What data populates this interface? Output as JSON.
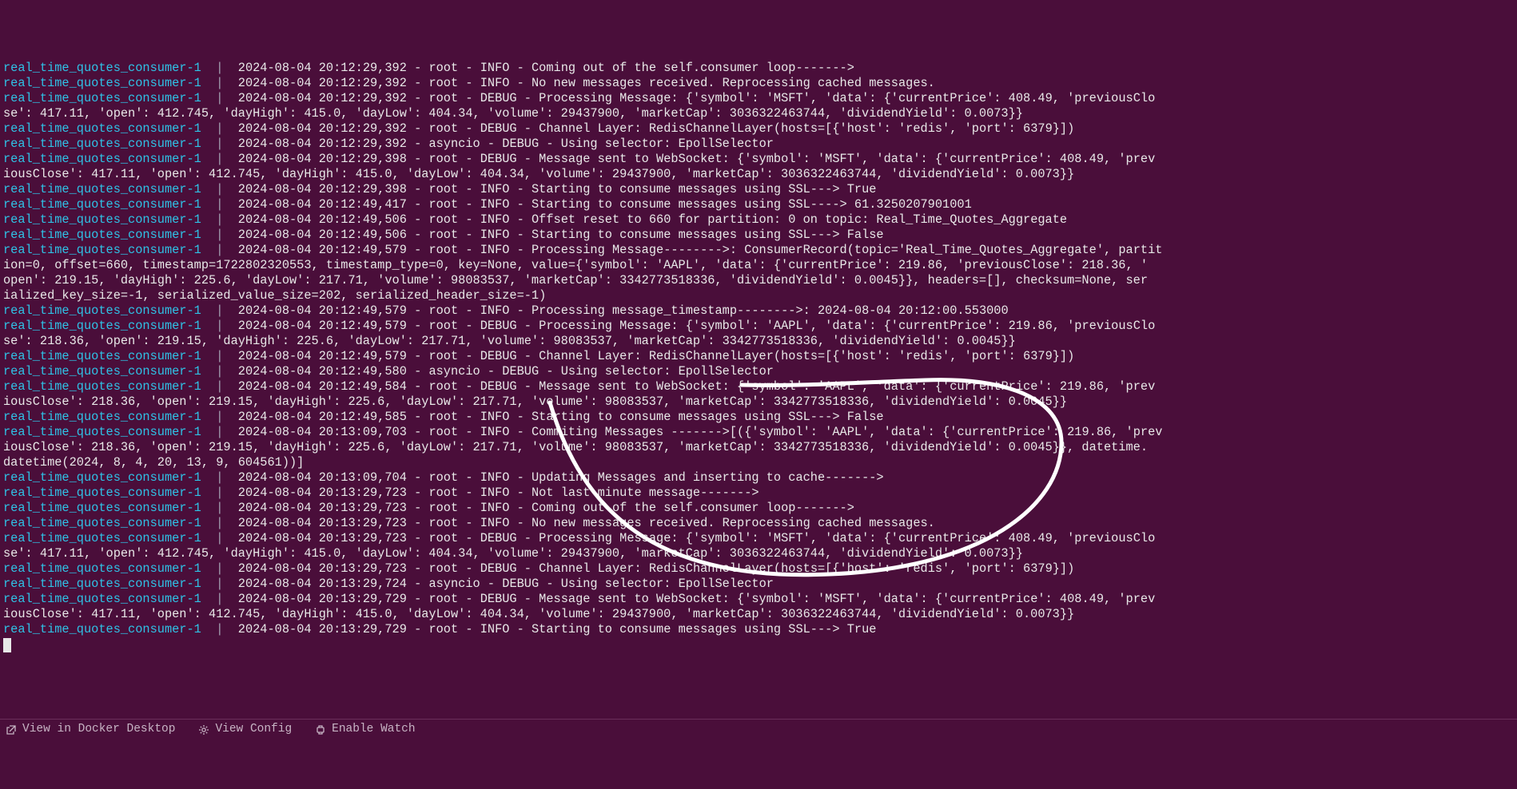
{
  "svc": "real_time_quotes_consumer-1",
  "pipe": "  | ",
  "dash": " - ",
  "lines": [
    {
      "svc": true,
      "ts": "2024-08-04 20:12:29,392",
      "logger": "root",
      "level": "INFO",
      "msg": "Coming out of the self.consumer loop------->"
    },
    {
      "svc": true,
      "ts": "2024-08-04 20:12:29,392",
      "logger": "root",
      "level": "INFO",
      "msg": "No new messages received. Reprocessing cached messages."
    },
    {
      "svc": true,
      "ts": "2024-08-04 20:12:29,392",
      "logger": "root",
      "level": "DEBUG",
      "msg": "Processing Message: {'symbol': 'MSFT', 'data': {'currentPrice': 408.49, 'previousClo"
    },
    {
      "cont": true,
      "msg": "se': 417.11, 'open': 412.745, 'dayHigh': 415.0, 'dayLow': 404.34, 'volume': 29437900, 'marketCap': 3036322463744, 'dividendYield': 0.0073}}"
    },
    {
      "svc": true,
      "ts": "2024-08-04 20:12:29,392",
      "logger": "root",
      "level": "DEBUG",
      "msg": "Channel Layer: RedisChannelLayer(hosts=[{'host': 'redis', 'port': 6379}])"
    },
    {
      "svc": true,
      "ts": "2024-08-04 20:12:29,392",
      "logger": "asyncio",
      "level": "DEBUG",
      "msg": "Using selector: EpollSelector"
    },
    {
      "svc": true,
      "ts": "2024-08-04 20:12:29,398",
      "logger": "root",
      "level": "DEBUG",
      "msg": "Message sent to WebSocket: {'symbol': 'MSFT', 'data': {'currentPrice': 408.49, 'prev"
    },
    {
      "cont": true,
      "msg": "iousClose': 417.11, 'open': 412.745, 'dayHigh': 415.0, 'dayLow': 404.34, 'volume': 29437900, 'marketCap': 3036322463744, 'dividendYield': 0.0073}}"
    },
    {
      "svc": true,
      "ts": "2024-08-04 20:12:29,398",
      "logger": "root",
      "level": "INFO",
      "msg": "Starting to consume messages using SSL---> True"
    },
    {
      "svc": true,
      "ts": "2024-08-04 20:12:49,417",
      "logger": "root",
      "level": "INFO",
      "msg": "Starting to consume messages using SSL----> 61.3250207901001"
    },
    {
      "svc": true,
      "ts": "2024-08-04 20:12:49,506",
      "logger": "root",
      "level": "INFO",
      "msg": "Offset reset to 660 for partition: 0 on topic: Real_Time_Quotes_Aggregate"
    },
    {
      "svc": true,
      "ts": "2024-08-04 20:12:49,506",
      "logger": "root",
      "level": "INFO",
      "msg": "Starting to consume messages using SSL---> False"
    },
    {
      "svc": true,
      "ts": "2024-08-04 20:12:49,579",
      "logger": "root",
      "level": "INFO",
      "msg": "Processing Message-------->: ConsumerRecord(topic='Real_Time_Quotes_Aggregate', partit"
    },
    {
      "cont": true,
      "msg": "ion=0, offset=660, timestamp=1722802320553, timestamp_type=0, key=None, value={'symbol': 'AAPL', 'data': {'currentPrice': 219.86, 'previousClose': 218.36, '"
    },
    {
      "cont": true,
      "msg": "open': 219.15, 'dayHigh': 225.6, 'dayLow': 217.71, 'volume': 98083537, 'marketCap': 3342773518336, 'dividendYield': 0.0045}}, headers=[], checksum=None, ser"
    },
    {
      "cont": true,
      "msg": "ialized_key_size=-1, serialized_value_size=202, serialized_header_size=-1)"
    },
    {
      "svc": true,
      "ts": "2024-08-04 20:12:49,579",
      "logger": "root",
      "level": "INFO",
      "msg": "Processing message_timestamp-------->: 2024-08-04 20:12:00.553000"
    },
    {
      "svc": true,
      "ts": "2024-08-04 20:12:49,579",
      "logger": "root",
      "level": "DEBUG",
      "msg": "Processing Message: {'symbol': 'AAPL', 'data': {'currentPrice': 219.86, 'previousClo"
    },
    {
      "cont": true,
      "msg": "se': 218.36, 'open': 219.15, 'dayHigh': 225.6, 'dayLow': 217.71, 'volume': 98083537, 'marketCap': 3342773518336, 'dividendYield': 0.0045}}"
    },
    {
      "svc": true,
      "ts": "2024-08-04 20:12:49,579",
      "logger": "root",
      "level": "DEBUG",
      "msg": "Channel Layer: RedisChannelLayer(hosts=[{'host': 'redis', 'port': 6379}])"
    },
    {
      "svc": true,
      "ts": "2024-08-04 20:12:49,580",
      "logger": "asyncio",
      "level": "DEBUG",
      "msg": "Using selector: EpollSelector"
    },
    {
      "svc": true,
      "ts": "2024-08-04 20:12:49,584",
      "logger": "root",
      "level": "DEBUG",
      "msg": "Message sent to WebSocket: {'symbol': 'AAPL', 'data': {'currentPrice': 219.86, 'prev"
    },
    {
      "cont": true,
      "msg": "iousClose': 218.36, 'open': 219.15, 'dayHigh': 225.6, 'dayLow': 217.71, 'volume': 98083537, 'marketCap': 3342773518336, 'dividendYield': 0.0045}}"
    },
    {
      "svc": true,
      "ts": "2024-08-04 20:12:49,585",
      "logger": "root",
      "level": "INFO",
      "msg": "Starting to consume messages using SSL---> False"
    },
    {
      "svc": true,
      "ts": "2024-08-04 20:13:09,703",
      "logger": "root",
      "level": "INFO",
      "msg": "Commiting Messages ------->[({'symbol': 'AAPL', 'data': {'currentPrice': 219.86, 'prev"
    },
    {
      "cont": true,
      "msg": "iousClose': 218.36, 'open': 219.15, 'dayHigh': 225.6, 'dayLow': 217.71, 'volume': 98083537, 'marketCap': 3342773518336, 'dividendYield': 0.0045}}, datetime."
    },
    {
      "cont": true,
      "msg": "datetime(2024, 8, 4, 20, 13, 9, 604561))]"
    },
    {
      "svc": true,
      "ts": "2024-08-04 20:13:09,704",
      "logger": "root",
      "level": "INFO",
      "msg": "Updating Messages and inserting to cache------->"
    },
    {
      "svc": true,
      "ts": "2024-08-04 20:13:29,723",
      "logger": "root",
      "level": "INFO",
      "msg": "Not last minute message------->"
    },
    {
      "svc": true,
      "ts": "2024-08-04 20:13:29,723",
      "logger": "root",
      "level": "INFO",
      "msg": "Coming out of the self.consumer loop------->"
    },
    {
      "svc": true,
      "ts": "2024-08-04 20:13:29,723",
      "logger": "root",
      "level": "INFO",
      "msg": "No new messages received. Reprocessing cached messages."
    },
    {
      "svc": true,
      "ts": "2024-08-04 20:13:29,723",
      "logger": "root",
      "level": "DEBUG",
      "msg": "Processing Message: {'symbol': 'MSFT', 'data': {'currentPrice': 408.49, 'previousClo"
    },
    {
      "cont": true,
      "msg": "se': 417.11, 'open': 412.745, 'dayHigh': 415.0, 'dayLow': 404.34, 'volume': 29437900, 'marketCap': 3036322463744, 'dividendYield': 0.0073}}"
    },
    {
      "svc": true,
      "ts": "2024-08-04 20:13:29,723",
      "logger": "root",
      "level": "DEBUG",
      "msg": "Channel Layer: RedisChannelLayer(hosts=[{'host': 'redis', 'port': 6379}])"
    },
    {
      "svc": true,
      "ts": "2024-08-04 20:13:29,724",
      "logger": "asyncio",
      "level": "DEBUG",
      "msg": "Using selector: EpollSelector"
    },
    {
      "svc": true,
      "ts": "2024-08-04 20:13:29,729",
      "logger": "root",
      "level": "DEBUG",
      "msg": "Message sent to WebSocket: {'symbol': 'MSFT', 'data': {'currentPrice': 408.49, 'prev"
    },
    {
      "cont": true,
      "msg": "iousClose': 417.11, 'open': 412.745, 'dayHigh': 415.0, 'dayLow': 404.34, 'volume': 29437900, 'marketCap': 3036322463744, 'dividendYield': 0.0073}}"
    },
    {
      "svc": true,
      "ts": "2024-08-04 20:13:29,729",
      "logger": "root",
      "level": "INFO",
      "msg": "Starting to consume messages using SSL---> True"
    }
  ],
  "statusbar": {
    "view_docker": "View in Docker Desktop",
    "view_config": "View Config",
    "enable_watch": "Enable Watch"
  }
}
